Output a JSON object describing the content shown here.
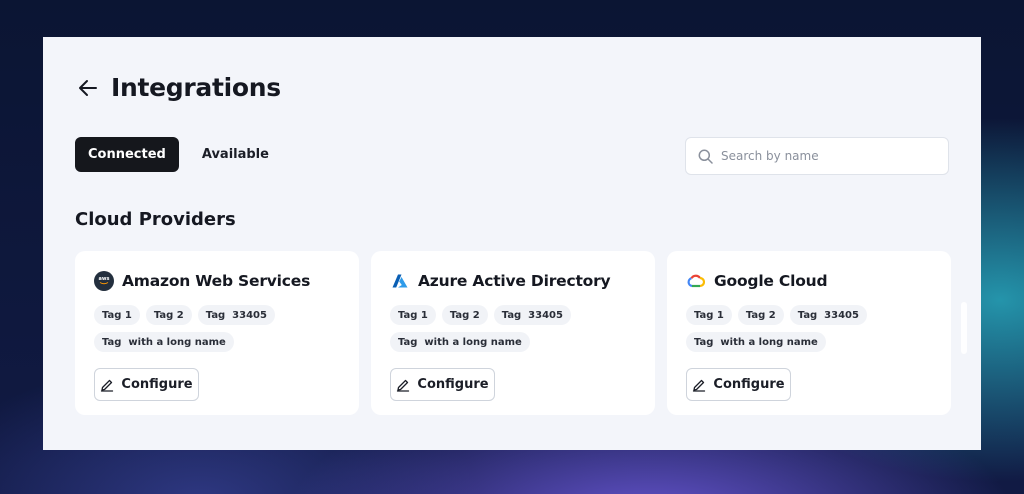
{
  "page": {
    "title": "Integrations"
  },
  "tabs": [
    {
      "label": "Connected",
      "active": true
    },
    {
      "label": "Available",
      "active": false
    }
  ],
  "search": {
    "placeholder": "Search by name",
    "value": ""
  },
  "section": {
    "title": "Cloud Providers"
  },
  "cards": [
    {
      "name": "Amazon Web Services",
      "logo": "aws-logo-icon",
      "logo_text": "aws",
      "tags": [
        "Tag 1",
        "Tag 2",
        "Tag  33405",
        "Tag  with a long name"
      ],
      "button": "Configure"
    },
    {
      "name": "Azure Active Directory",
      "logo": "azure-logo-icon",
      "tags": [
        "Tag 1",
        "Tag 2",
        "Tag  33405",
        "Tag  with a long name"
      ],
      "button": "Configure"
    },
    {
      "name": "Google Cloud",
      "logo": "google-cloud-logo-icon",
      "tags": [
        "Tag 1",
        "Tag 2",
        "Tag  33405",
        "Tag  with a long name"
      ],
      "button": "Configure"
    }
  ],
  "colors": {
    "primary_dark": "#15171c",
    "panel_bg": "#f3f5fa",
    "card_bg": "#ffffff",
    "tag_bg": "#f1f3f7"
  },
  "icons": {
    "back": "arrow-left-icon",
    "search": "search-icon",
    "edit": "pencil-icon"
  }
}
